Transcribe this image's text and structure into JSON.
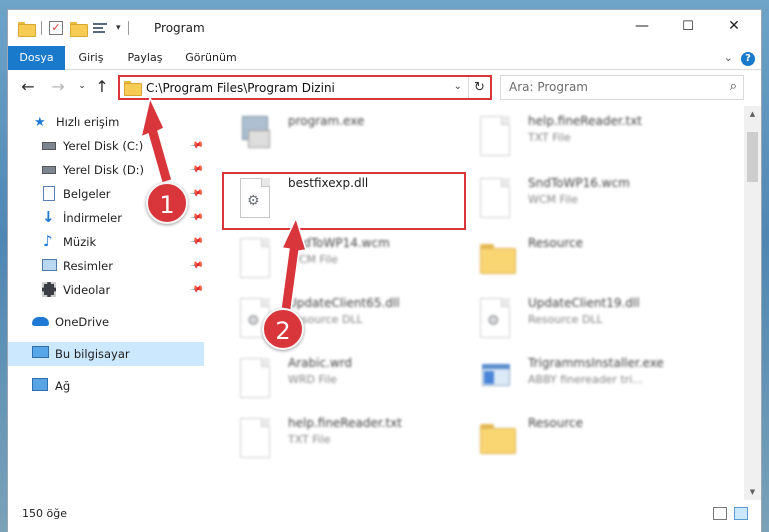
{
  "window": {
    "title": "Program",
    "controls": {
      "minimize": "—",
      "maximize": "☐",
      "close": "✕"
    }
  },
  "ribbon": {
    "tabs": [
      {
        "label": "Dosya"
      },
      {
        "label": "Giriş"
      },
      {
        "label": "Paylaş"
      },
      {
        "label": "Görünüm"
      }
    ],
    "help": "?"
  },
  "navigation": {
    "address_path": "C:\\Program Files\\Program Dizini",
    "search_placeholder": "Ara: Program"
  },
  "sidebar": {
    "items": [
      {
        "label": "Hızlı erişim",
        "icon": "star-icon"
      },
      {
        "label": "Yerel Disk (C:)",
        "icon": "drive-icon",
        "pinned": true
      },
      {
        "label": "Yerel Disk (D:)",
        "icon": "drive-icon",
        "pinned": true
      },
      {
        "label": "Belgeler",
        "icon": "documents-icon",
        "pinned": true
      },
      {
        "label": "İndirmeler",
        "icon": "downloads-icon",
        "pinned": true
      },
      {
        "label": "Müzik",
        "icon": "music-icon",
        "pinned": true
      },
      {
        "label": "Resimler",
        "icon": "pictures-icon",
        "pinned": true
      },
      {
        "label": "Videolar",
        "icon": "videos-icon",
        "pinned": true
      },
      {
        "label": "OneDrive",
        "icon": "cloud-icon"
      },
      {
        "label": "Bu bilgisayar",
        "icon": "computer-icon",
        "selected": true
      },
      {
        "label": "Ağ",
        "icon": "network-icon"
      }
    ]
  },
  "files": [
    {
      "name": "program.exe",
      "type": "",
      "icon": "installer-icon"
    },
    {
      "name": "help.fineReader.txt",
      "type": "TXT File",
      "icon": "text-file-icon"
    },
    {
      "name": "bestfixexp.dll",
      "type": "",
      "icon": "dll-file-icon",
      "highlighted": true
    },
    {
      "name": "SndToWP16.wcm",
      "type": "WCM File",
      "icon": "file-icon"
    },
    {
      "name": "SndToWP14.wcm",
      "type": "WCM File",
      "icon": "file-icon"
    },
    {
      "name": "Resource",
      "type": "",
      "icon": "folder-icon"
    },
    {
      "name": "UpdateClient65.dll",
      "type": "Resource DLL",
      "icon": "dll-file-icon"
    },
    {
      "name": "UpdateClient19.dll",
      "type": "Resource DLL",
      "icon": "dll-file-icon"
    },
    {
      "name": "Arabic.wrd",
      "type": "WRD File",
      "icon": "file-icon"
    },
    {
      "name": "TrigrammsInstaller.exe",
      "type": "ABBY finereader tri...",
      "icon": "exe-icon"
    },
    {
      "name": "help.fineReader.txt",
      "type": "TXT File",
      "icon": "text-file-icon"
    },
    {
      "name": "Resource",
      "type": "",
      "icon": "folder-icon"
    }
  ],
  "status": {
    "count": "150 öğe"
  },
  "callouts": {
    "one": "1",
    "two": "2"
  }
}
